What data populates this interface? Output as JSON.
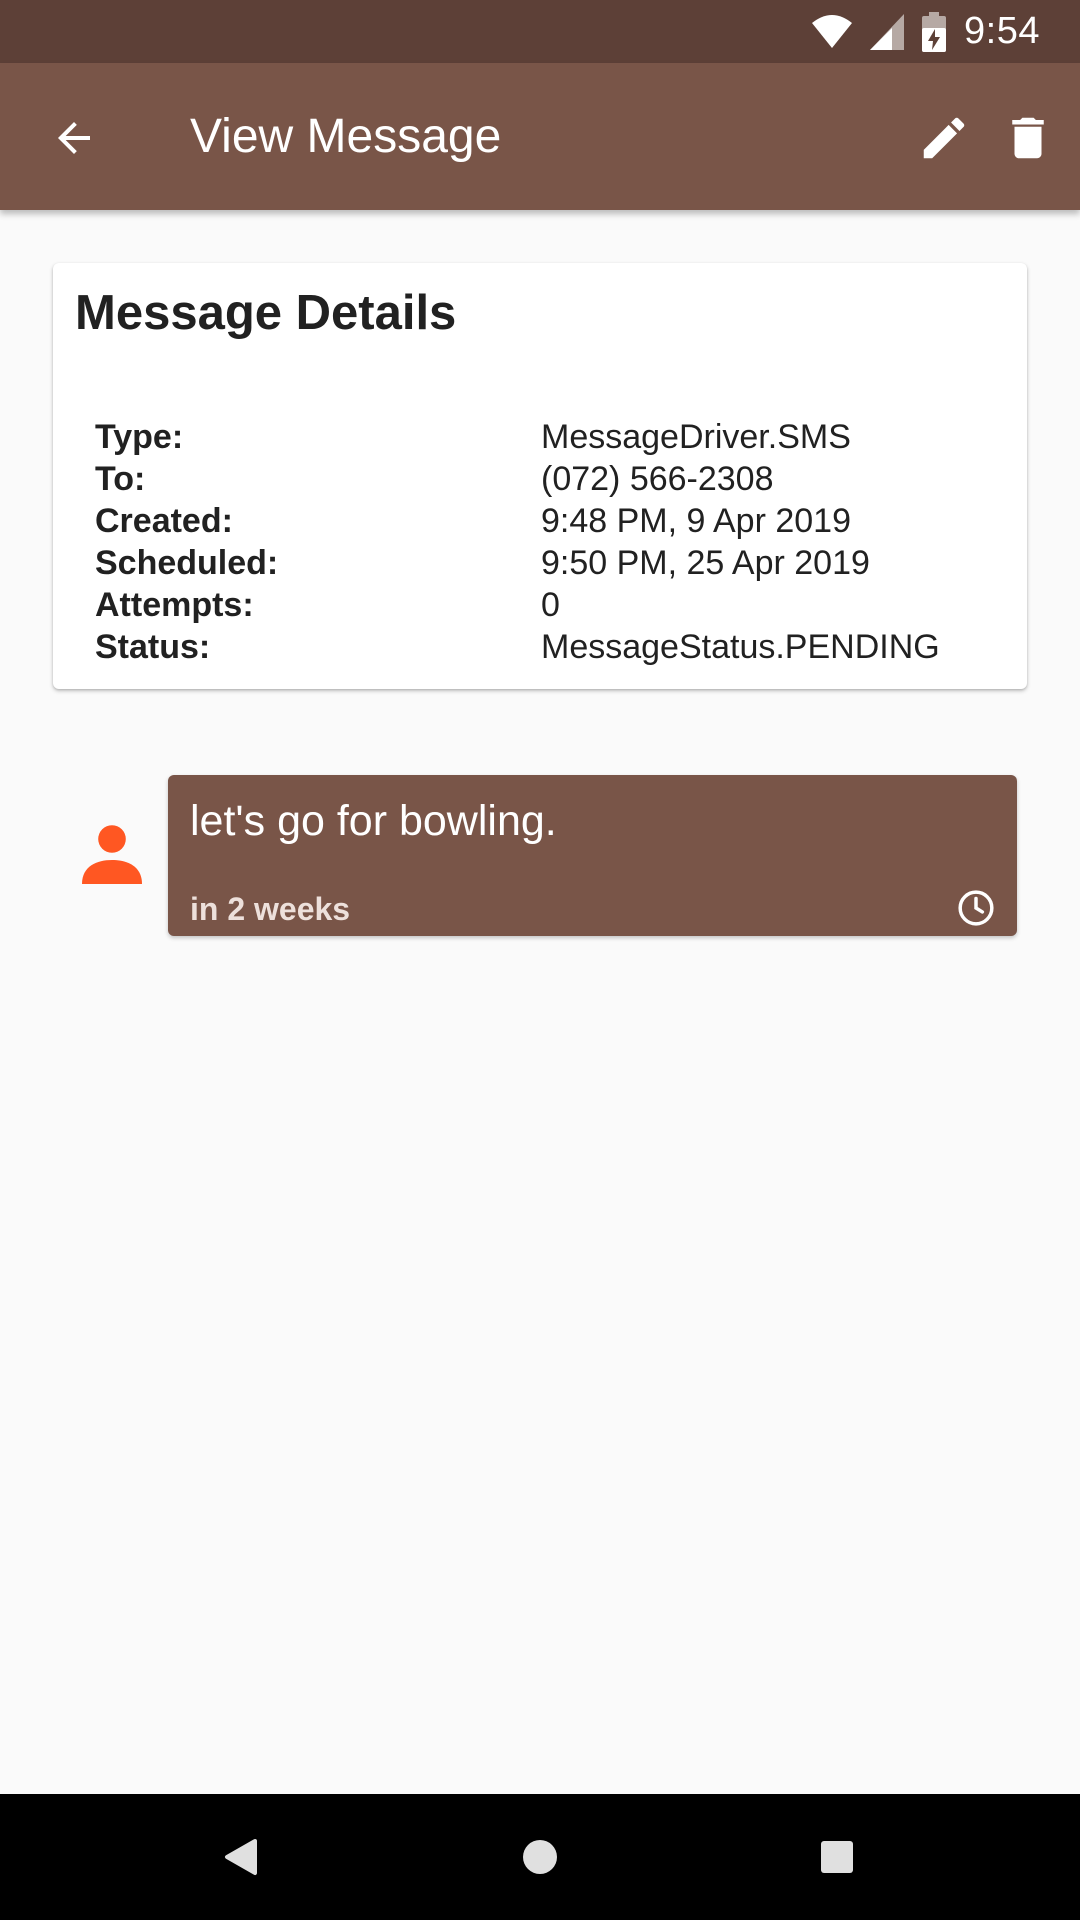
{
  "status_bar": {
    "time": "9:54",
    "icons": [
      "wifi-icon",
      "signal-icon",
      "battery-charging-icon"
    ]
  },
  "app_bar": {
    "title": "View Message",
    "actions": [
      "back-arrow-icon",
      "edit-pencil-icon",
      "delete-trash-icon"
    ],
    "background_color": "#795548"
  },
  "card": {
    "title": "Message Details",
    "rows": [
      {
        "label": "Type:",
        "value": "MessageDriver.SMS"
      },
      {
        "label": "To:",
        "value": "(072) 566-2308"
      },
      {
        "label": "Created:",
        "value": "9:48 PM, 9 Apr 2019"
      },
      {
        "label": "Scheduled:",
        "value": "9:50 PM, 25 Apr 2019"
      },
      {
        "label": "Attempts:",
        "value": "0"
      },
      {
        "label": "Status:",
        "value": "MessageStatus.PENDING"
      }
    ]
  },
  "message": {
    "avatar_icon": "person-icon",
    "avatar_color": "#ff5722",
    "text": "let's go for bowling.",
    "schedule": "in 2 weeks",
    "status_icon": "clock-icon",
    "bubble_color": "#795548"
  },
  "nav_bar": {
    "buttons": [
      "nav-back-icon",
      "nav-home-icon",
      "nav-recents-icon"
    ]
  }
}
